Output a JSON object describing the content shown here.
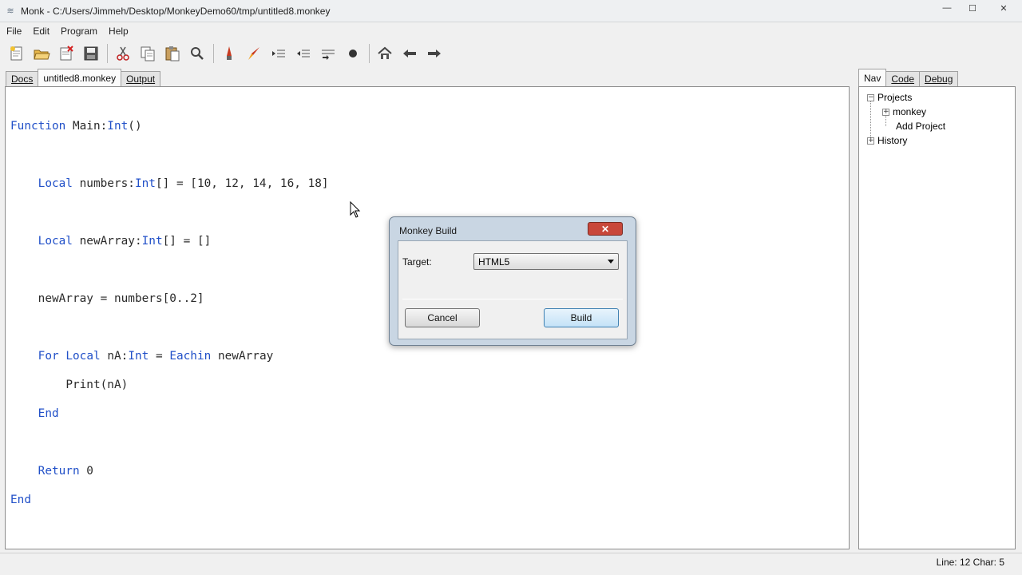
{
  "window": {
    "title": "Monk - C:/Users/Jimmeh/Desktop/MonkeyDemo60/tmp/untitled8.monkey",
    "minimize": "—",
    "maximize": "☐",
    "close": "✕"
  },
  "menu": [
    "File",
    "Edit",
    "Program",
    "Help"
  ],
  "toolbar_icons": [
    "new-file-icon",
    "open-folder-icon",
    "close-file-icon",
    "save-icon",
    "cut-icon",
    "copy-icon",
    "paste-icon",
    "find-icon",
    "build-icon",
    "build-run-icon",
    "indent-icon",
    "outdent-icon",
    "step-icon",
    "breakpoint-icon",
    "home-icon",
    "back-arrow-icon",
    "forward-arrow-icon"
  ],
  "tabs_left": [
    {
      "label": "Docs",
      "active": false
    },
    {
      "label": "untitled8.monkey",
      "active": true
    },
    {
      "label": "Output",
      "active": false
    }
  ],
  "tabs_right": [
    {
      "label": "Nav",
      "active": true
    },
    {
      "label": "Code",
      "active": false
    },
    {
      "label": "Debug",
      "active": false
    }
  ],
  "code": {
    "line1": {
      "kw1": "Function",
      "t1": " Main:",
      "kw2": "Int",
      "t2": "()"
    },
    "line2": {
      "kw1": "Local",
      "t1": " numbers:",
      "kw2": "Int",
      "t2": "[] = [10, 12, 14, 16, 18]"
    },
    "line3": {
      "kw1": "Local",
      "t1": " newArray:",
      "kw2": "Int",
      "t2": "[] = []"
    },
    "line4": {
      "t1": "newArray = numbers[0..2]"
    },
    "line5": {
      "kw1": "For",
      "kw2": "Local",
      "t1": " nA:",
      "kw3": "Int",
      "t2": " = ",
      "kw4": "Eachin",
      "t3": " newArray"
    },
    "line6": {
      "t1": "Print(nA)"
    },
    "line7": {
      "kw1": "End"
    },
    "line8": {
      "kw1": "Return",
      "t1": " 0"
    },
    "line9": {
      "kw1": "End"
    }
  },
  "nav_tree": {
    "projects": "Projects",
    "monkey": "monkey",
    "add_project": "Add Project",
    "history": "History"
  },
  "status": {
    "text": "Line: 12 Char: 5"
  },
  "dialog": {
    "title": "Monkey Build",
    "close": "✕",
    "target_label": "Target:",
    "target_value": "HTML5",
    "cancel": "Cancel",
    "build": "Build"
  }
}
